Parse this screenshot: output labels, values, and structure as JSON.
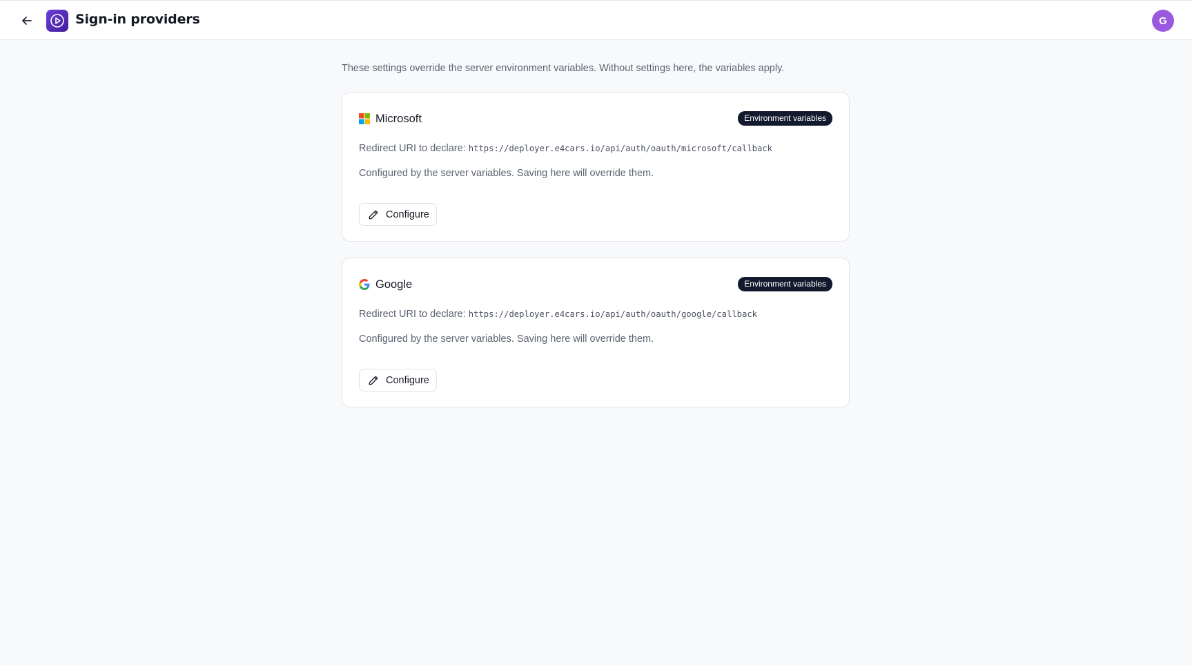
{
  "header": {
    "title": "Sign-in providers",
    "avatar_initial": "G",
    "avatar_color": "#9b59e0",
    "logo_color": "#5b2fc4"
  },
  "intro": "These settings override the server environment variables. Without settings here, the variables apply.",
  "providers": [
    {
      "name": "Microsoft",
      "icon": "microsoft-logo-icon",
      "badge": "Environment variables",
      "redirect_label": "Redirect URI to declare:",
      "redirect_uri": "https://deployer.e4cars.io/api/auth/oauth/microsoft/callback",
      "status": "Configured by the server variables. Saving here will override them.",
      "button_label": "Configure"
    },
    {
      "name": "Google",
      "icon": "google-logo-icon",
      "badge": "Environment variables",
      "redirect_label": "Redirect URI to declare:",
      "redirect_uri": "https://deployer.e4cars.io/api/auth/oauth/google/callback",
      "status": "Configured by the server variables. Saving here will override them.",
      "button_label": "Configure"
    }
  ],
  "colors": {
    "badge_bg": "#141a2e",
    "page_bg": "#f8f9fb"
  }
}
